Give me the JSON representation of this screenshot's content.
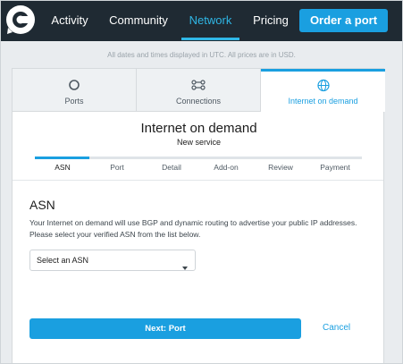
{
  "navbar": {
    "logo_icon": "brand-logo",
    "links": [
      {
        "label": "Activity",
        "active": false
      },
      {
        "label": "Community",
        "active": false
      },
      {
        "label": "Network",
        "active": true
      },
      {
        "label": "Pricing",
        "active": false
      }
    ],
    "order_button_label": "Order a port"
  },
  "notice": "All dates and times displayed in UTC. All prices are in USD.",
  "tabs": [
    {
      "label": "Ports",
      "icon": "circle-icon",
      "active": false
    },
    {
      "label": "Connections",
      "icon": "connections-icon",
      "active": false
    },
    {
      "label": "Internet on demand",
      "icon": "globe-icon",
      "active": true
    }
  ],
  "page": {
    "title": "Internet on demand",
    "subtitle": "New service"
  },
  "stepper": {
    "steps": [
      {
        "label": "ASN",
        "active": true
      },
      {
        "label": "Port",
        "active": false
      },
      {
        "label": "Detail",
        "active": false
      },
      {
        "label": "Add-on",
        "active": false
      },
      {
        "label": "Review",
        "active": false
      },
      {
        "label": "Payment",
        "active": false
      }
    ]
  },
  "section": {
    "title": "ASN",
    "description": "Your Internet on demand will use BGP and dynamic routing to advertise your public IP addresses. Please select your verified ASN from the list below."
  },
  "asn_select": {
    "value": "Select an ASN"
  },
  "actions": {
    "next_label": "Next: Port",
    "cancel_label": "Cancel"
  },
  "colors": {
    "navbar_bg": "#1f2a33",
    "accent": "#1a9fe0",
    "active_nav": "#2fb7e6"
  }
}
